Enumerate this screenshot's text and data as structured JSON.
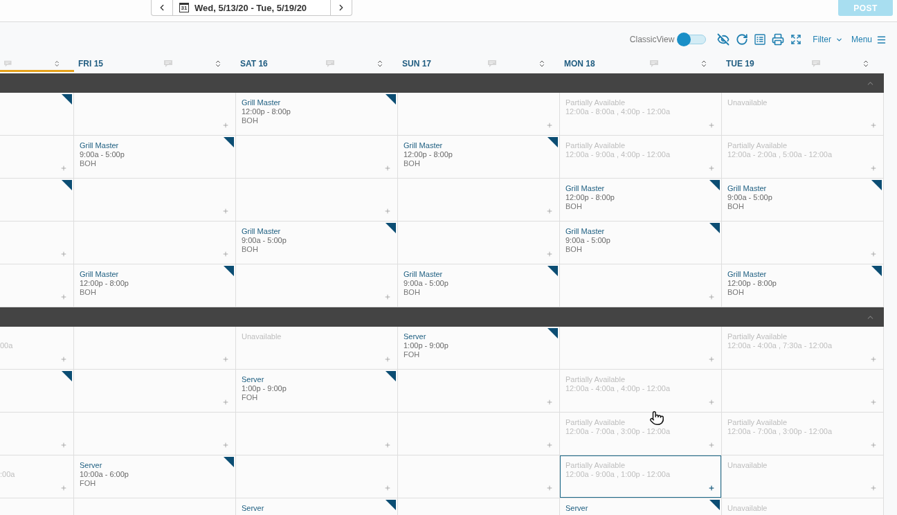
{
  "date_nav": {
    "calendar_day": "31",
    "range": "Wed, 5/13/20 - Tue, 5/19/20"
  },
  "post_button": {
    "label": "POST",
    "disabled": true
  },
  "toolbar": {
    "classic_view": {
      "label": "ClassicView",
      "on": false
    },
    "filter": {
      "label": "Filter"
    },
    "menu": {
      "label": "Menu"
    }
  },
  "columns": [
    {
      "highlighted": true
    },
    {
      "label": "FRI 15",
      "highlighted": false
    },
    {
      "label": "SAT 16",
      "highlighted": false
    },
    {
      "label": "SUN 17",
      "highlighted": false
    },
    {
      "label": "MON 18",
      "highlighted": false
    },
    {
      "label": "TUE 19",
      "highlighted": false
    }
  ],
  "groups": [
    {
      "expanded": true,
      "rows": [
        {
          "cells": [
            {
              "kind": "shift",
              "selected": false
            },
            {
              "kind": "empty",
              "selected": false
            },
            {
              "kind": "shift",
              "title": "Grill Master",
              "time": "12:00p - 8:00p",
              "station": "BOH",
              "selected": false
            },
            {
              "kind": "empty",
              "selected": false
            },
            {
              "kind": "availability",
              "status": "Partially Available",
              "hours": "12:00a - 8:00a , 4:00p - 12:00a",
              "selected": false
            },
            {
              "kind": "availability",
              "status": "Unavailable",
              "selected": false
            }
          ]
        },
        {
          "cells": [
            {
              "kind": "empty",
              "selected": false
            },
            {
              "kind": "shift",
              "title": "Grill Master",
              "time": "9:00a - 5:00p",
              "station": "BOH",
              "selected": false
            },
            {
              "kind": "empty",
              "selected": false
            },
            {
              "kind": "shift",
              "title": "Grill Master",
              "time": "12:00p - 8:00p",
              "station": "BOH",
              "selected": false
            },
            {
              "kind": "availability",
              "status": "Partially Available",
              "hours": "12:00a - 9:00a , 4:00p - 12:00a",
              "selected": false
            },
            {
              "kind": "availability",
              "status": "Partially Available",
              "hours": "12:00a - 2:00a , 5:00a - 12:00a",
              "selected": false
            }
          ]
        },
        {
          "cells": [
            {
              "kind": "shift",
              "selected": false
            },
            {
              "kind": "empty",
              "selected": false
            },
            {
              "kind": "empty",
              "selected": false
            },
            {
              "kind": "empty",
              "selected": false
            },
            {
              "kind": "shift",
              "title": "Grill Master",
              "time": "12:00p - 8:00p",
              "station": "BOH",
              "selected": false
            },
            {
              "kind": "shift",
              "title": "Grill Master",
              "time": "9:00a - 5:00p",
              "station": "BOH",
              "selected": false
            }
          ]
        },
        {
          "cells": [
            {
              "kind": "empty",
              "selected": false
            },
            {
              "kind": "empty",
              "selected": false
            },
            {
              "kind": "shift",
              "title": "Grill Master",
              "time": "9:00a - 5:00p",
              "station": "BOH",
              "selected": false
            },
            {
              "kind": "empty",
              "selected": false
            },
            {
              "kind": "shift",
              "title": "Grill Master",
              "time": "9:00a - 5:00p",
              "station": "BOH",
              "selected": false
            },
            {
              "kind": "empty",
              "selected": false
            }
          ]
        },
        {
          "cells": [
            {
              "kind": "empty",
              "selected": false
            },
            {
              "kind": "shift",
              "title": "Grill Master",
              "time": "12:00p - 8:00p",
              "station": "BOH",
              "selected": false
            },
            {
              "kind": "empty",
              "selected": false
            },
            {
              "kind": "shift",
              "title": "Grill Master",
              "time": "9:00a - 5:00p",
              "station": "BOH",
              "selected": false
            },
            {
              "kind": "empty",
              "selected": false
            },
            {
              "kind": "shift",
              "title": "Grill Master",
              "time": "12:00p - 8:00p",
              "station": "BOH",
              "selected": false
            }
          ]
        }
      ]
    },
    {
      "expanded": true,
      "rows": [
        {
          "cells": [
            {
              "kind": "availability",
              "hours": "00a",
              "selected": false
            },
            {
              "kind": "empty",
              "selected": false
            },
            {
              "kind": "availability",
              "status": "Unavailable",
              "selected": false
            },
            {
              "kind": "shift",
              "title": "Server",
              "time": "1:00p - 9:00p",
              "station": "FOH",
              "selected": false
            },
            {
              "kind": "empty",
              "selected": false
            },
            {
              "kind": "availability",
              "status": "Partially Available",
              "hours": "12:00a - 4:00a , 7:30a - 12:00a",
              "selected": false
            }
          ]
        },
        {
          "cells": [
            {
              "kind": "shift",
              "selected": false
            },
            {
              "kind": "empty",
              "selected": false
            },
            {
              "kind": "shift",
              "title": "Server",
              "time": "1:00p - 9:00p",
              "station": "FOH",
              "selected": false
            },
            {
              "kind": "empty",
              "selected": false
            },
            {
              "kind": "availability",
              "status": "Partially Available",
              "hours": "12:00a - 4:00a , 4:00p - 12:00a",
              "selected": false
            },
            {
              "kind": "empty",
              "selected": false
            }
          ]
        },
        {
          "cells": [
            {
              "kind": "empty",
              "selected": false
            },
            {
              "kind": "empty",
              "selected": false
            },
            {
              "kind": "empty",
              "selected": false
            },
            {
              "kind": "empty",
              "selected": false
            },
            {
              "kind": "availability",
              "status": "Partially Available",
              "hours": "12:00a - 7:00a , 3:00p - 12:00a",
              "selected": false
            },
            {
              "kind": "availability",
              "status": "Partially Available",
              "hours": "12:00a - 7:00a , 3:00p - 12:00a",
              "selected": false
            }
          ]
        },
        {
          "cells": [
            {
              "kind": "availability",
              "hours": ":00a",
              "selected": false
            },
            {
              "kind": "shift",
              "title": "Server",
              "time": "10:00a - 6:00p",
              "station": "FOH",
              "selected": false
            },
            {
              "kind": "empty",
              "selected": false
            },
            {
              "kind": "empty",
              "selected": false
            },
            {
              "kind": "availability",
              "status": "Partially Available",
              "hours": "12:00a - 9:00a , 1:00p - 12:00a",
              "selected": true
            },
            {
              "kind": "availability",
              "status": "Unavailable",
              "selected": false
            }
          ]
        },
        {
          "cells": [
            {
              "kind": "empty",
              "selected": false
            },
            {
              "kind": "empty",
              "selected": false
            },
            {
              "kind": "shift",
              "title": "Server",
              "selected": false
            },
            {
              "kind": "empty",
              "selected": false
            },
            {
              "kind": "shift",
              "title": "Server",
              "selected": false
            },
            {
              "kind": "availability",
              "status": "Unavailable",
              "selected": false
            }
          ]
        }
      ]
    }
  ]
}
